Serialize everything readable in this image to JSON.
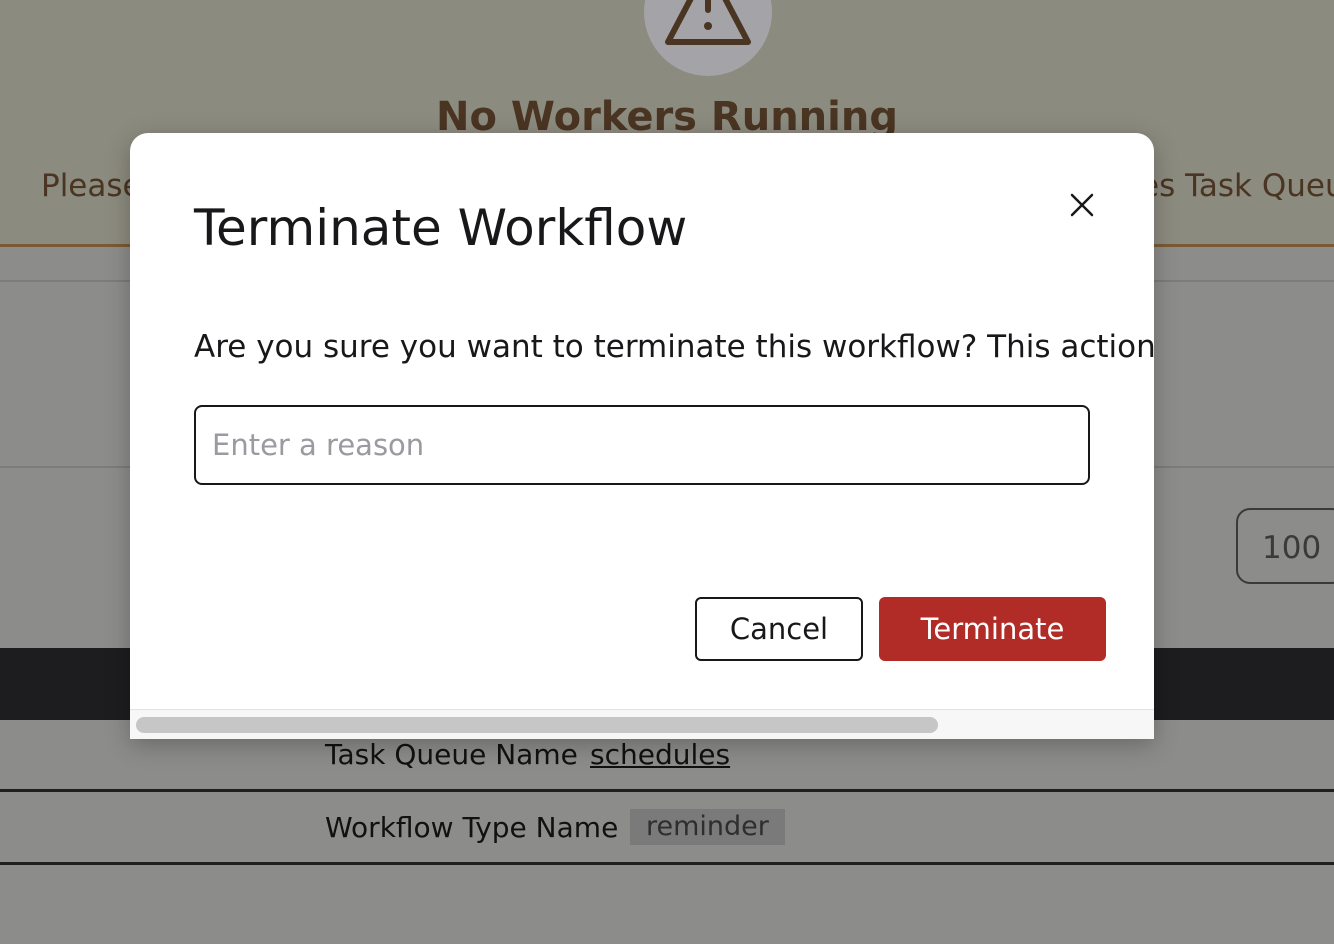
{
  "background": {
    "banner": {
      "icon": "warning-triangle-icon",
      "title": "No Workers Running",
      "text_left": "Please",
      "text_right": "es Task Queu"
    },
    "page_size_value": "100",
    "details": [
      {
        "label": "Task Queue Name",
        "value": "schedules"
      },
      {
        "label": "Workflow Type Name",
        "value": "reminder"
      }
    ]
  },
  "modal": {
    "title": "Terminate Workflow",
    "close_icon": "close-icon",
    "message": "Are you sure you want to terminate this workflow? This action c",
    "reason_placeholder": "Enter a reason",
    "reason_value": "",
    "cancel_label": "Cancel",
    "terminate_label": "Terminate"
  },
  "colors": {
    "terminate_button": "#b22c27",
    "banner_text": "#4a3422",
    "banner_border": "#7a5a32"
  }
}
